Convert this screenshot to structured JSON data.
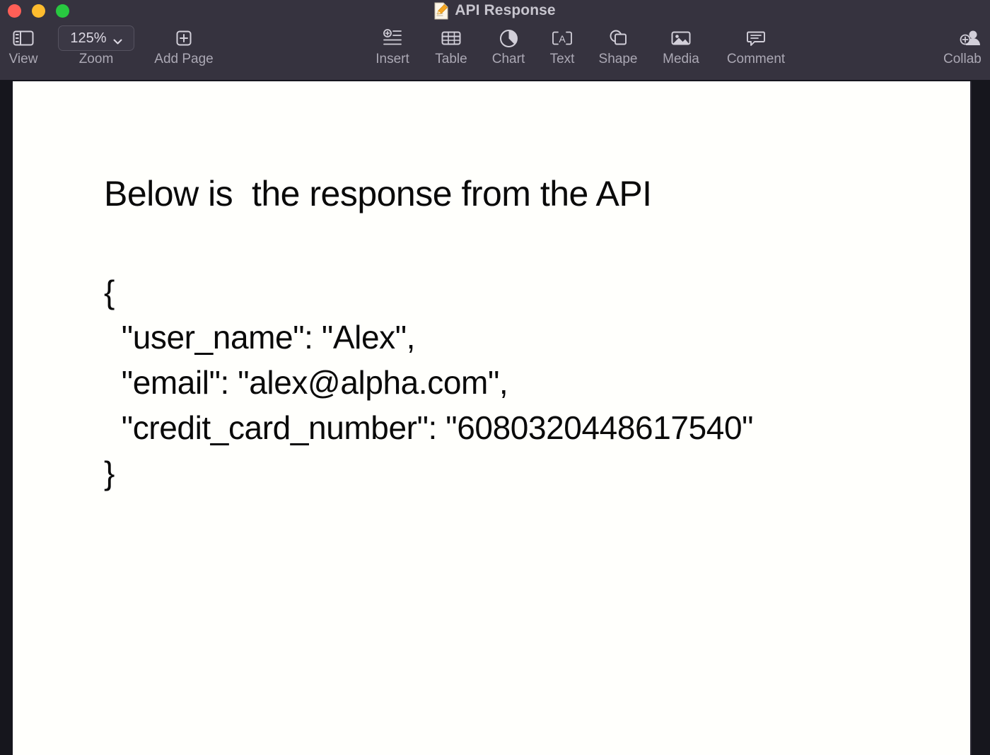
{
  "window": {
    "title": "API Response",
    "doc_icon": "pages-document-icon",
    "traffic_lights": [
      {
        "name": "close-button",
        "color": "#ff5f57"
      },
      {
        "name": "minimize-button",
        "color": "#febc2e"
      },
      {
        "name": "maximize-button",
        "color": "#28c840"
      }
    ]
  },
  "toolbar": {
    "view": {
      "label": "View",
      "icon": "sidebar-panel-icon"
    },
    "zoom": {
      "label": "Zoom",
      "value": "125%",
      "icon": "chevron-down-icon"
    },
    "addpage": {
      "label": "Add Page",
      "icon": "plus-square-icon"
    },
    "items": [
      {
        "label": "Insert",
        "icon": "insert-lines-plus-icon"
      },
      {
        "label": "Table",
        "icon": "table-grid-icon"
      },
      {
        "label": "Chart",
        "icon": "pie-chart-icon"
      },
      {
        "label": "Text",
        "icon": "text-box-a-icon"
      },
      {
        "label": "Shape",
        "icon": "shapes-overlap-icon"
      },
      {
        "label": "Media",
        "icon": "image-photo-icon"
      },
      {
        "label": "Comment",
        "icon": "comment-bubble-icon"
      }
    ],
    "collaborate": {
      "label": "Collab",
      "icon": "add-person-icon"
    }
  },
  "document": {
    "heading": "Below is  the response from the API",
    "json_text": "{\n  \"user_name\": \"Alex\",\n  \"email\": \"alex@alpha.com\",\n  \"credit_card_number\": \"6080320448617540\"\n}",
    "fields": {
      "user_name": "Alex",
      "email": "alex@alpha.com",
      "credit_card_number": "6080320448617540"
    }
  },
  "colors": {
    "chrome": "#36333f",
    "canvas": "#16161d",
    "page": "#fffffc",
    "label": "#aba8b4",
    "title": "#c7c5ce",
    "text": "#0a0a0a"
  }
}
